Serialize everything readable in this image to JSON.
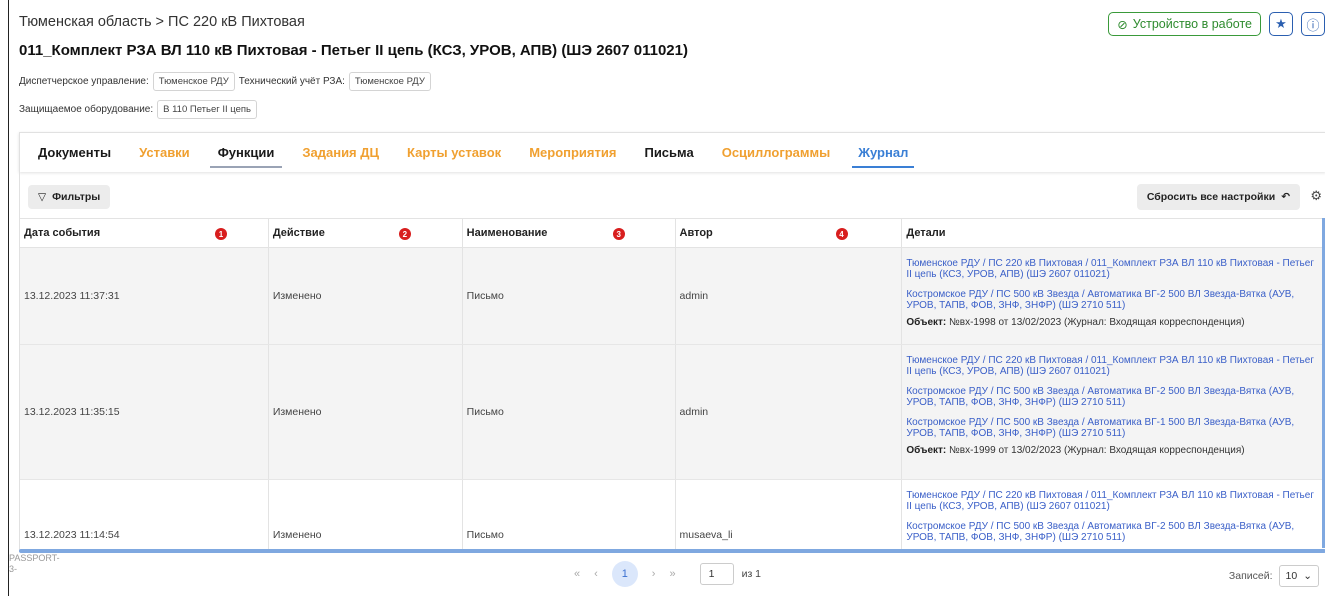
{
  "header": {
    "breadcrumb": "Тюменская область > ПС 220 кВ Пихтовая",
    "status_button": "Устройство в работе",
    "title": "011_Комплект РЗА ВЛ 110 кВ Пихтовая - Петьег II цепь (КСЗ, УРОВ, АПВ) (ШЭ 2607 011021)"
  },
  "meta": {
    "dispatch_label": "Диспетчерское управление:",
    "dispatch_value": "Тюменское РДУ",
    "tech_label": "Технический учёт РЗА:",
    "tech_value": "Тюменское РДУ",
    "equipment_label": "Защищаемое оборудование:",
    "equipment_value": "В 110 Петьег II цепь"
  },
  "tabs": [
    {
      "label": "Документы",
      "color": "#1a1a1a"
    },
    {
      "label": "Уставки",
      "color": "#f0a030"
    },
    {
      "label": "Функции",
      "color": "#1a1a1a"
    },
    {
      "label": "Задания ДЦ",
      "color": "#f0a030"
    },
    {
      "label": "Карты уставок",
      "color": "#f0a030"
    },
    {
      "label": "Мероприятия",
      "color": "#f0a030"
    },
    {
      "label": "Письма",
      "color": "#1a1a1a"
    },
    {
      "label": "Осциллограммы",
      "color": "#f0a030"
    },
    {
      "label": "Журнал",
      "color": "#3a7fd5"
    }
  ],
  "toolbar": {
    "filters": "Фильтры",
    "reset": "Сбросить все настройки"
  },
  "table": {
    "columns": [
      "Дата события",
      "Действие",
      "Наименование",
      "Автор",
      "Детали"
    ],
    "badges": [
      "1",
      "2",
      "3",
      "4"
    ],
    "rows": [
      {
        "date": "13.12.2023 11:37:31",
        "action": "Изменено",
        "name": "Письмо",
        "author": "admin",
        "links": [
          "Тюменское РДУ / ПС 220 кВ Пихтовая / 011_Комплект РЗА ВЛ 110 кВ Пихтовая - Петьег II цепь (КСЗ, УРОВ, АПВ) (ШЭ 2607 011021)",
          "Костромское РДУ / ПС 500 кВ Звезда / Автоматика ВГ-2 500 ВЛ Звезда-Вятка (АУВ, УРОВ, ТАПВ, ФОВ, ЗНФ, ЗНФР) (ШЭ 2710 511)"
        ],
        "object_label": "Объект:",
        "object_value": "№вх-1998 от 13/02/2023 (Журнал: Входящая корреспонденция)"
      },
      {
        "date": "13.12.2023 11:35:15",
        "action": "Изменено",
        "name": "Письмо",
        "author": "admin",
        "links": [
          "Тюменское РДУ / ПС 220 кВ Пихтовая / 011_Комплект РЗА ВЛ 110 кВ Пихтовая - Петьег II цепь (КСЗ, УРОВ, АПВ) (ШЭ 2607 011021)",
          "Костромское РДУ / ПС 500 кВ Звезда / Автоматика ВГ-2 500 ВЛ Звезда-Вятка (АУВ, УРОВ, ТАПВ, ФОВ, ЗНФ, ЗНФР) (ШЭ 2710 511)",
          "Костромское РДУ / ПС 500 кВ Звезда / Автоматика ВГ-1 500 ВЛ Звезда-Вятка (АУВ, УРОВ, ТАПВ, ФОВ, ЗНФ, ЗНФР) (ШЭ 2710 511)"
        ],
        "object_label": "Объект:",
        "object_value": "№вх-1999 от 13/02/2023 (Журнал: Входящая корреспонденция)"
      },
      {
        "date": "13.12.2023 11:14:54",
        "action": "Изменено",
        "name": "Письмо",
        "author": "musaeva_li",
        "links": [
          "Тюменское РДУ / ПС 220 кВ Пихтовая / 011_Комплект РЗА ВЛ 110 кВ Пихтовая - Петьег II цепь (КСЗ, УРОВ, АПВ) (ШЭ 2607 011021)",
          "Костромское РДУ / ПС 500 кВ Звезда / Автоматика ВГ-2 500 ВЛ Звезда-Вятка (АУВ, УРОВ, ТАПВ, ФОВ, ЗНФ, ЗНФР) (ШЭ 2710 511)"
        ],
        "object_label": "",
        "object_value": ""
      }
    ]
  },
  "side_label": "PASSPORT-\n3-",
  "pagination": {
    "first": "«",
    "prev": "‹",
    "current": "1",
    "next": "›",
    "last": "»",
    "input_value": "1",
    "of_text": "из 1",
    "records_label": "Записей:",
    "records_value": "10"
  }
}
